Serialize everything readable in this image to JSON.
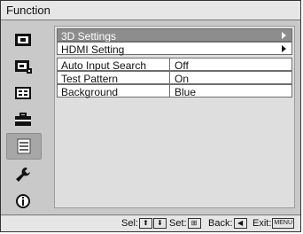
{
  "title": "Function",
  "sidebar": {
    "items": [
      {
        "icon": "picture-icon",
        "selected": false
      },
      {
        "icon": "advanced-picture-icon",
        "selected": false
      },
      {
        "icon": "screen-icon",
        "selected": false
      },
      {
        "icon": "setup-toolbox-icon",
        "selected": false
      },
      {
        "icon": "function-list-icon",
        "selected": true
      },
      {
        "icon": "wrench-icon",
        "selected": false
      },
      {
        "icon": "info-icon",
        "selected": false
      }
    ]
  },
  "menu": {
    "items": [
      {
        "label": "3D Settings",
        "value": "",
        "highlighted": true,
        "has_submenu": true
      },
      {
        "label": "HDMI Setting",
        "value": "",
        "highlighted": false,
        "has_submenu": true
      },
      {
        "label": "Auto Input Search",
        "value": "Off"
      },
      {
        "label": "Test Pattern",
        "value": "On"
      },
      {
        "label": "Background",
        "value": "Blue"
      }
    ]
  },
  "status": {
    "sel_label": "Sel:",
    "set_label": "Set:",
    "back_label": "Back:",
    "exit_label": "Exit:",
    "exit_key": "MENU",
    "sel_up": "⬆",
    "sel_down": "⬇",
    "back_key": "◀"
  },
  "colors": {
    "frame_bg": "#c9c9c9",
    "title_bg": "#e6e6e6",
    "highlight": "#8d8d8d",
    "selected_icon_bg": "#a7a7a7"
  }
}
